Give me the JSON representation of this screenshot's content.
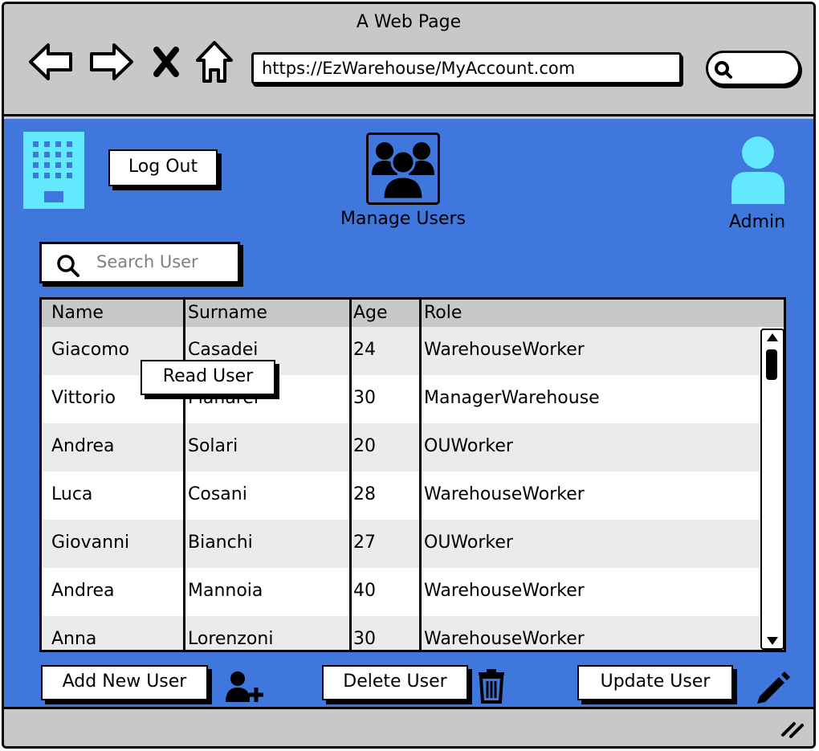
{
  "window": {
    "title": "A Web Page"
  },
  "browser": {
    "url": "https://EzWarehouse/MyAccount.com",
    "icons": [
      "back-arrow-icon",
      "forward-arrow-icon",
      "close-x-icon",
      "home-icon",
      "search-icon"
    ]
  },
  "header": {
    "logout_label": "Log Out",
    "page_title": "Manage Users",
    "user_label": "Admin"
  },
  "search": {
    "placeholder": "Search User"
  },
  "table": {
    "columns": [
      "Name",
      "Surname",
      "Age",
      "Role"
    ],
    "rows": [
      [
        "Giacomo",
        "Casadei",
        "24",
        "WarehouseWorker"
      ],
      [
        "Vittorio",
        "Pianarei",
        "30",
        "ManagerWarehouse"
      ],
      [
        "Andrea",
        "Solari",
        "20",
        "OUWorker"
      ],
      [
        "Luca",
        "Cosani",
        "28",
        "WarehouseWorker"
      ],
      [
        "Giovanni",
        "Bianchi",
        "27",
        "OUWorker"
      ],
      [
        "Andrea",
        "Mannoia",
        "40",
        "WarehouseWorker"
      ],
      [
        "Anna",
        "Lorenzoni",
        "30",
        "WarehouseWorker"
      ]
    ]
  },
  "tooltip": {
    "label": "Read User"
  },
  "actions": {
    "add_label": "Add New User",
    "delete_label": "Delete User",
    "update_label": "Update User"
  },
  "colors": {
    "background": "#3f77dc",
    "accent": "#62e8ff",
    "chrome": "#c8c8c8"
  }
}
